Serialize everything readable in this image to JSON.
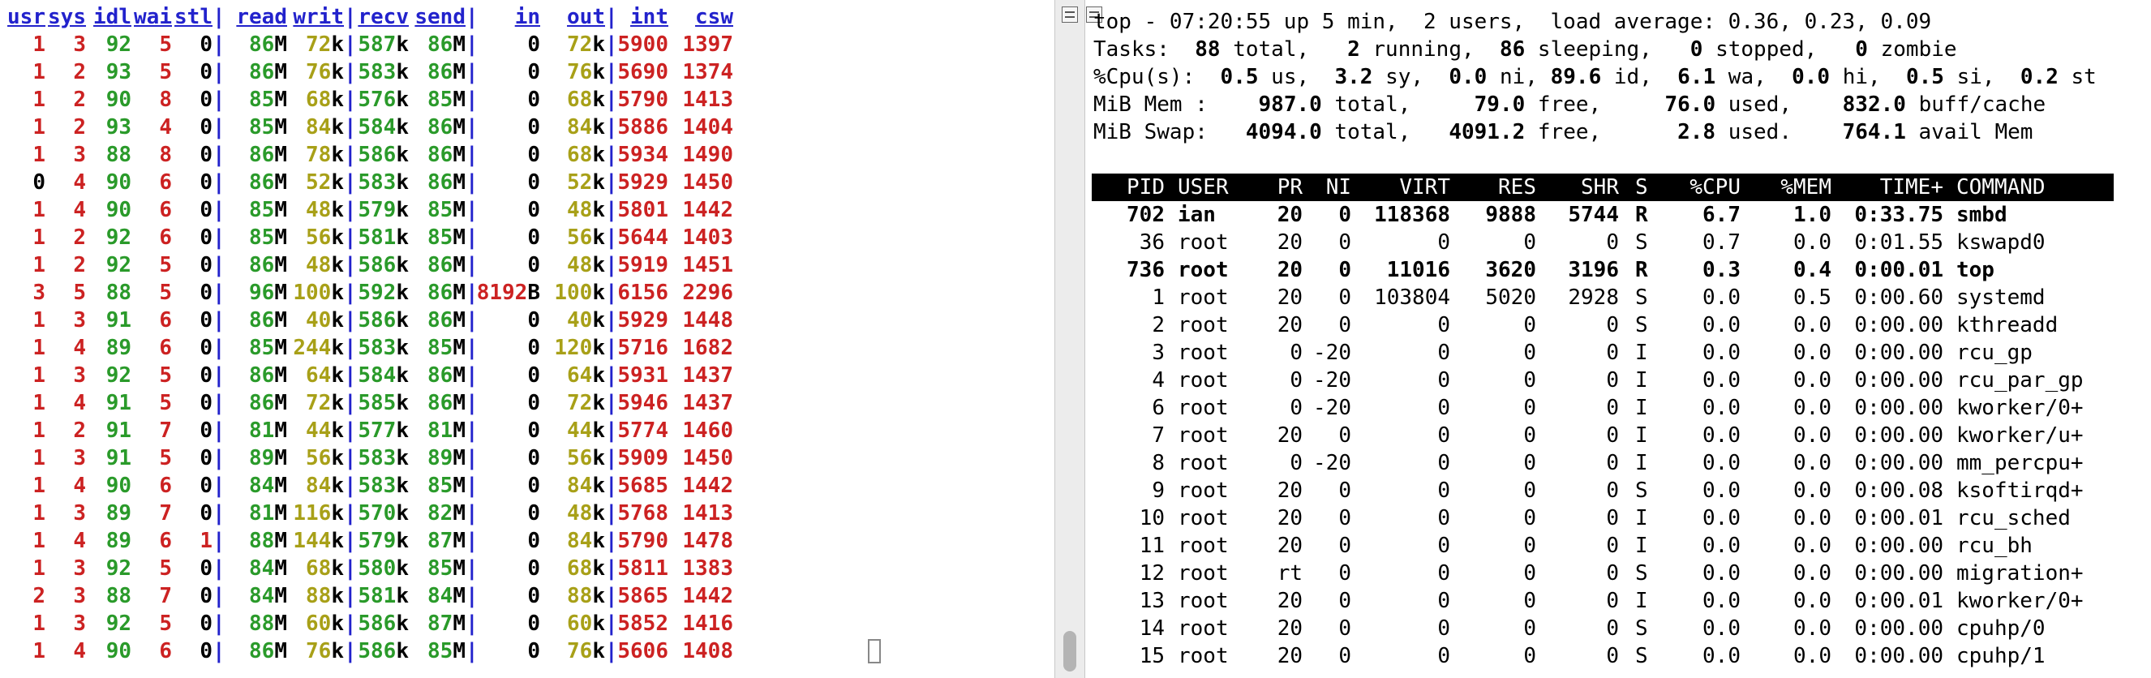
{
  "dstat": {
    "headers": [
      "usr",
      "sys",
      "idl",
      "wai",
      "stl",
      "read",
      "writ",
      "recv",
      "send",
      "in",
      "out",
      "int",
      "csw"
    ],
    "rows": [
      [
        "1",
        "3",
        "92",
        "5",
        "0",
        "86M",
        "72k",
        "587k",
        "86M",
        "0",
        "72k",
        "5900",
        "1397"
      ],
      [
        "1",
        "2",
        "93",
        "5",
        "0",
        "86M",
        "76k",
        "583k",
        "86M",
        "0",
        "76k",
        "5690",
        "1374"
      ],
      [
        "1",
        "2",
        "90",
        "8",
        "0",
        "85M",
        "68k",
        "576k",
        "85M",
        "0",
        "68k",
        "5790",
        "1413"
      ],
      [
        "1",
        "2",
        "93",
        "4",
        "0",
        "85M",
        "84k",
        "584k",
        "86M",
        "0",
        "84k",
        "5886",
        "1404"
      ],
      [
        "1",
        "3",
        "88",
        "8",
        "0",
        "86M",
        "78k",
        "586k",
        "86M",
        "0",
        "68k",
        "5934",
        "1490"
      ],
      [
        "0",
        "4",
        "90",
        "6",
        "0",
        "86M",
        "52k",
        "583k",
        "86M",
        "0",
        "52k",
        "5929",
        "1450"
      ],
      [
        "1",
        "4",
        "90",
        "6",
        "0",
        "85M",
        "48k",
        "579k",
        "85M",
        "0",
        "48k",
        "5801",
        "1442"
      ],
      [
        "1",
        "2",
        "92",
        "6",
        "0",
        "85M",
        "56k",
        "581k",
        "85M",
        "0",
        "56k",
        "5644",
        "1403"
      ],
      [
        "1",
        "2",
        "92",
        "5",
        "0",
        "86M",
        "48k",
        "586k",
        "86M",
        "0",
        "48k",
        "5919",
        "1451"
      ],
      [
        "3",
        "5",
        "88",
        "5",
        "0",
        "96M",
        "100k",
        "592k",
        "86M",
        "8192B",
        "100k",
        "6156",
        "2296"
      ],
      [
        "1",
        "3",
        "91",
        "6",
        "0",
        "86M",
        "40k",
        "586k",
        "86M",
        "0",
        "40k",
        "5929",
        "1448"
      ],
      [
        "1",
        "4",
        "89",
        "6",
        "0",
        "85M",
        "244k",
        "583k",
        "85M",
        "0",
        "120k",
        "5716",
        "1682"
      ],
      [
        "1",
        "3",
        "92",
        "5",
        "0",
        "86M",
        "64k",
        "584k",
        "86M",
        "0",
        "64k",
        "5931",
        "1437"
      ],
      [
        "1",
        "4",
        "91",
        "5",
        "0",
        "86M",
        "72k",
        "585k",
        "86M",
        "0",
        "72k",
        "5946",
        "1437"
      ],
      [
        "1",
        "2",
        "91",
        "7",
        "0",
        "81M",
        "44k",
        "577k",
        "81M",
        "0",
        "44k",
        "5774",
        "1460"
      ],
      [
        "1",
        "3",
        "91",
        "5",
        "0",
        "89M",
        "56k",
        "583k",
        "89M",
        "0",
        "56k",
        "5909",
        "1450"
      ],
      [
        "1",
        "4",
        "90",
        "6",
        "0",
        "84M",
        "84k",
        "583k",
        "85M",
        "0",
        "84k",
        "5685",
        "1442"
      ],
      [
        "1",
        "3",
        "89",
        "7",
        "0",
        "81M",
        "116k",
        "570k",
        "82M",
        "0",
        "48k",
        "5768",
        "1413"
      ],
      [
        "1",
        "4",
        "89",
        "6",
        "1",
        "88M",
        "144k",
        "579k",
        "87M",
        "0",
        "84k",
        "5790",
        "1478"
      ],
      [
        "1",
        "3",
        "92",
        "5",
        "0",
        "84M",
        "68k",
        "580k",
        "85M",
        "0",
        "68k",
        "5811",
        "1383"
      ],
      [
        "2",
        "3",
        "88",
        "7",
        "0",
        "84M",
        "88k",
        "581k",
        "84M",
        "0",
        "88k",
        "5865",
        "1442"
      ],
      [
        "1",
        "3",
        "92",
        "5",
        "0",
        "88M",
        "60k",
        "586k",
        "87M",
        "0",
        "60k",
        "5852",
        "1416"
      ],
      [
        "1",
        "4",
        "90",
        "6",
        "0",
        "86M",
        "76k",
        "586k",
        "85M",
        "0",
        "76k",
        "5606",
        "1408"
      ]
    ],
    "colors": {
      "header": "#2222cc",
      "red": "#cc2222",
      "green": "#2a9a2a",
      "yellow": "#a8a018"
    }
  },
  "top": {
    "summary": [
      "top - 07:20:55 up 5 min,  2 users,  load average: 0.36, 0.23, 0.09",
      "Tasks:  88 total,   2 running,  86 sleeping,   0 stopped,   0 zombie",
      "%Cpu(s):  0.5 us,  3.2 sy,  0.0 ni, 89.6 id,  6.1 wa,  0.0 hi,  0.5 si,  0.2 st",
      "MiB Mem :    987.0 total,     79.0 free,     76.0 used,    832.0 buff/cache",
      "MiB Swap:   4094.0 total,   4091.2 free,      2.8 used.    764.1 avail Mem"
    ],
    "columns": [
      "PID",
      "USER",
      "PR",
      "NI",
      "VIRT",
      "RES",
      "SHR",
      "S",
      "%CPU",
      "%MEM",
      "TIME+",
      "COMMAND"
    ],
    "processes": [
      {
        "pid": "702",
        "user": "ian",
        "pr": "20",
        "ni": "0",
        "virt": "118368",
        "res": "9888",
        "shr": "5744",
        "s": "R",
        "cpu": "6.7",
        "mem": "1.0",
        "time": "0:33.75",
        "cmd": "smbd",
        "bold": true
      },
      {
        "pid": "36",
        "user": "root",
        "pr": "20",
        "ni": "0",
        "virt": "0",
        "res": "0",
        "shr": "0",
        "s": "S",
        "cpu": "0.7",
        "mem": "0.0",
        "time": "0:01.55",
        "cmd": "kswapd0",
        "bold": false
      },
      {
        "pid": "736",
        "user": "root",
        "pr": "20",
        "ni": "0",
        "virt": "11016",
        "res": "3620",
        "shr": "3196",
        "s": "R",
        "cpu": "0.3",
        "mem": "0.4",
        "time": "0:00.01",
        "cmd": "top",
        "bold": true
      },
      {
        "pid": "1",
        "user": "root",
        "pr": "20",
        "ni": "0",
        "virt": "103804",
        "res": "5020",
        "shr": "2928",
        "s": "S",
        "cpu": "0.0",
        "mem": "0.5",
        "time": "0:00.60",
        "cmd": "systemd",
        "bold": false
      },
      {
        "pid": "2",
        "user": "root",
        "pr": "20",
        "ni": "0",
        "virt": "0",
        "res": "0",
        "shr": "0",
        "s": "S",
        "cpu": "0.0",
        "mem": "0.0",
        "time": "0:00.00",
        "cmd": "kthreadd",
        "bold": false
      },
      {
        "pid": "3",
        "user": "root",
        "pr": "0",
        "ni": "-20",
        "virt": "0",
        "res": "0",
        "shr": "0",
        "s": "I",
        "cpu": "0.0",
        "mem": "0.0",
        "time": "0:00.00",
        "cmd": "rcu_gp",
        "bold": false
      },
      {
        "pid": "4",
        "user": "root",
        "pr": "0",
        "ni": "-20",
        "virt": "0",
        "res": "0",
        "shr": "0",
        "s": "I",
        "cpu": "0.0",
        "mem": "0.0",
        "time": "0:00.00",
        "cmd": "rcu_par_gp",
        "bold": false
      },
      {
        "pid": "6",
        "user": "root",
        "pr": "0",
        "ni": "-20",
        "virt": "0",
        "res": "0",
        "shr": "0",
        "s": "I",
        "cpu": "0.0",
        "mem": "0.0",
        "time": "0:00.00",
        "cmd": "kworker/0+",
        "bold": false
      },
      {
        "pid": "7",
        "user": "root",
        "pr": "20",
        "ni": "0",
        "virt": "0",
        "res": "0",
        "shr": "0",
        "s": "I",
        "cpu": "0.0",
        "mem": "0.0",
        "time": "0:00.00",
        "cmd": "kworker/u+",
        "bold": false
      },
      {
        "pid": "8",
        "user": "root",
        "pr": "0",
        "ni": "-20",
        "virt": "0",
        "res": "0",
        "shr": "0",
        "s": "I",
        "cpu": "0.0",
        "mem": "0.0",
        "time": "0:00.00",
        "cmd": "mm_percpu+",
        "bold": false
      },
      {
        "pid": "9",
        "user": "root",
        "pr": "20",
        "ni": "0",
        "virt": "0",
        "res": "0",
        "shr": "0",
        "s": "S",
        "cpu": "0.0",
        "mem": "0.0",
        "time": "0:00.08",
        "cmd": "ksoftirqd+",
        "bold": false
      },
      {
        "pid": "10",
        "user": "root",
        "pr": "20",
        "ni": "0",
        "virt": "0",
        "res": "0",
        "shr": "0",
        "s": "I",
        "cpu": "0.0",
        "mem": "0.0",
        "time": "0:00.01",
        "cmd": "rcu_sched",
        "bold": false
      },
      {
        "pid": "11",
        "user": "root",
        "pr": "20",
        "ni": "0",
        "virt": "0",
        "res": "0",
        "shr": "0",
        "s": "I",
        "cpu": "0.0",
        "mem": "0.0",
        "time": "0:00.00",
        "cmd": "rcu_bh",
        "bold": false
      },
      {
        "pid": "12",
        "user": "root",
        "pr": "rt",
        "ni": "0",
        "virt": "0",
        "res": "0",
        "shr": "0",
        "s": "S",
        "cpu": "0.0",
        "mem": "0.0",
        "time": "0:00.00",
        "cmd": "migration+",
        "bold": false
      },
      {
        "pid": "13",
        "user": "root",
        "pr": "20",
        "ni": "0",
        "virt": "0",
        "res": "0",
        "shr": "0",
        "s": "I",
        "cpu": "0.0",
        "mem": "0.0",
        "time": "0:00.01",
        "cmd": "kworker/0+",
        "bold": false
      },
      {
        "pid": "14",
        "user": "root",
        "pr": "20",
        "ni": "0",
        "virt": "0",
        "res": "0",
        "shr": "0",
        "s": "S",
        "cpu": "0.0",
        "mem": "0.0",
        "time": "0:00.00",
        "cmd": "cpuhp/0",
        "bold": false
      },
      {
        "pid": "15",
        "user": "root",
        "pr": "20",
        "ni": "0",
        "virt": "0",
        "res": "0",
        "shr": "0",
        "s": "S",
        "cpu": "0.0",
        "mem": "0.0",
        "time": "0:00.00",
        "cmd": "cpuhp/1",
        "bold": false
      }
    ]
  }
}
